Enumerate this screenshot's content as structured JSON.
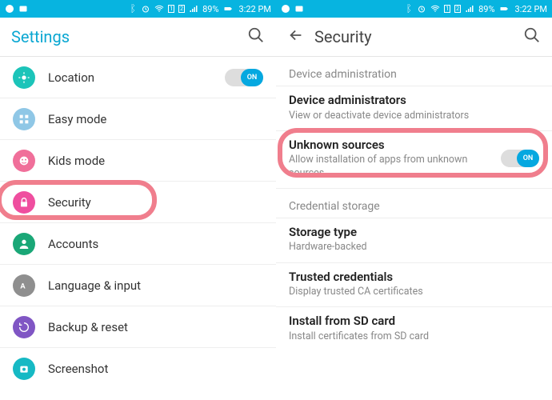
{
  "status": {
    "battery_pct": "89%",
    "time": "3:22 PM"
  },
  "left": {
    "app_title": "Settings",
    "items": [
      {
        "label": "Location",
        "icon_bg": "#1cc4b9",
        "toggle": "ON"
      },
      {
        "label": "Easy mode",
        "icon_bg": "#8fc7e6"
      },
      {
        "label": "Kids mode",
        "icon_bg": "#f06f9a"
      },
      {
        "label": "Security",
        "icon_bg": "#ef4e9f",
        "highlight": true
      },
      {
        "label": "Accounts",
        "icon_bg": "#1aa777"
      },
      {
        "label": "Language & input",
        "icon_bg": "#8f8f8f"
      },
      {
        "label": "Backup & reset",
        "icon_bg": "#8056c4"
      },
      {
        "label": "Screenshot",
        "icon_bg": "#16b9c4"
      }
    ]
  },
  "right": {
    "app_title": "Security",
    "section1": "Device administration",
    "item_devadm_title": "Device administrators",
    "item_devadm_sub": "View or deactivate device administrators",
    "item_unk_title": "Unknown sources",
    "item_unk_sub": "Allow installation of apps from unknown sources",
    "item_unk_toggle": "ON",
    "section2": "Credential storage",
    "item_stor_title": "Storage type",
    "item_stor_sub": "Hardware-backed",
    "item_trusted_title": "Trusted credentials",
    "item_trusted_sub": "Display trusted CA certificates",
    "item_sd_title": "Install from SD card",
    "item_sd_sub": "Install certificates from SD card"
  }
}
